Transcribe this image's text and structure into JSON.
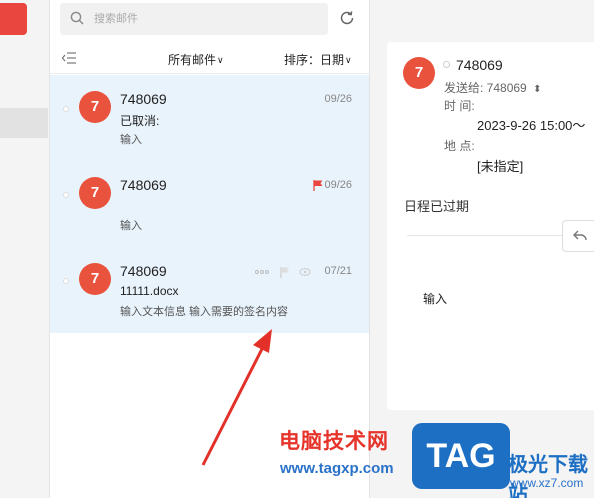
{
  "search": {
    "placeholder": "搜索邮件"
  },
  "toolbar": {
    "filter_label": "所有邮件",
    "sort_label": "排序：日期"
  },
  "mails": [
    {
      "avatar": "7",
      "sender": "748069",
      "date": "09/26",
      "subject": "已取消:",
      "preview": "输入"
    },
    {
      "avatar": "7",
      "sender": "748069",
      "date": "09/26",
      "subject": "",
      "preview": "输入",
      "flag_color": "#e8463f"
    },
    {
      "avatar": "7",
      "sender": "748069",
      "date": "07/21",
      "subject": "11111.docx",
      "preview": "输入文本信息 输入需要的签名内容"
    }
  ],
  "detail": {
    "avatar": "7",
    "sender": "748069",
    "send_to": "发送给: 748069",
    "time_label": "时 间:",
    "time_value": "2023-9-26 15:00～",
    "place_label": "地 点:",
    "place_value": "[未指定]",
    "expired": "日程已过期",
    "body": "输入"
  },
  "watermark": {
    "title": "电脑技术网",
    "url": "www.tagxp.com",
    "tag": "TAG",
    "site": "极光下载站",
    "small": "www.xz7.com"
  },
  "colors": {
    "accent": "#e8463f",
    "selected_bg": "#e9f3fc",
    "avatar": "#e9523d"
  }
}
